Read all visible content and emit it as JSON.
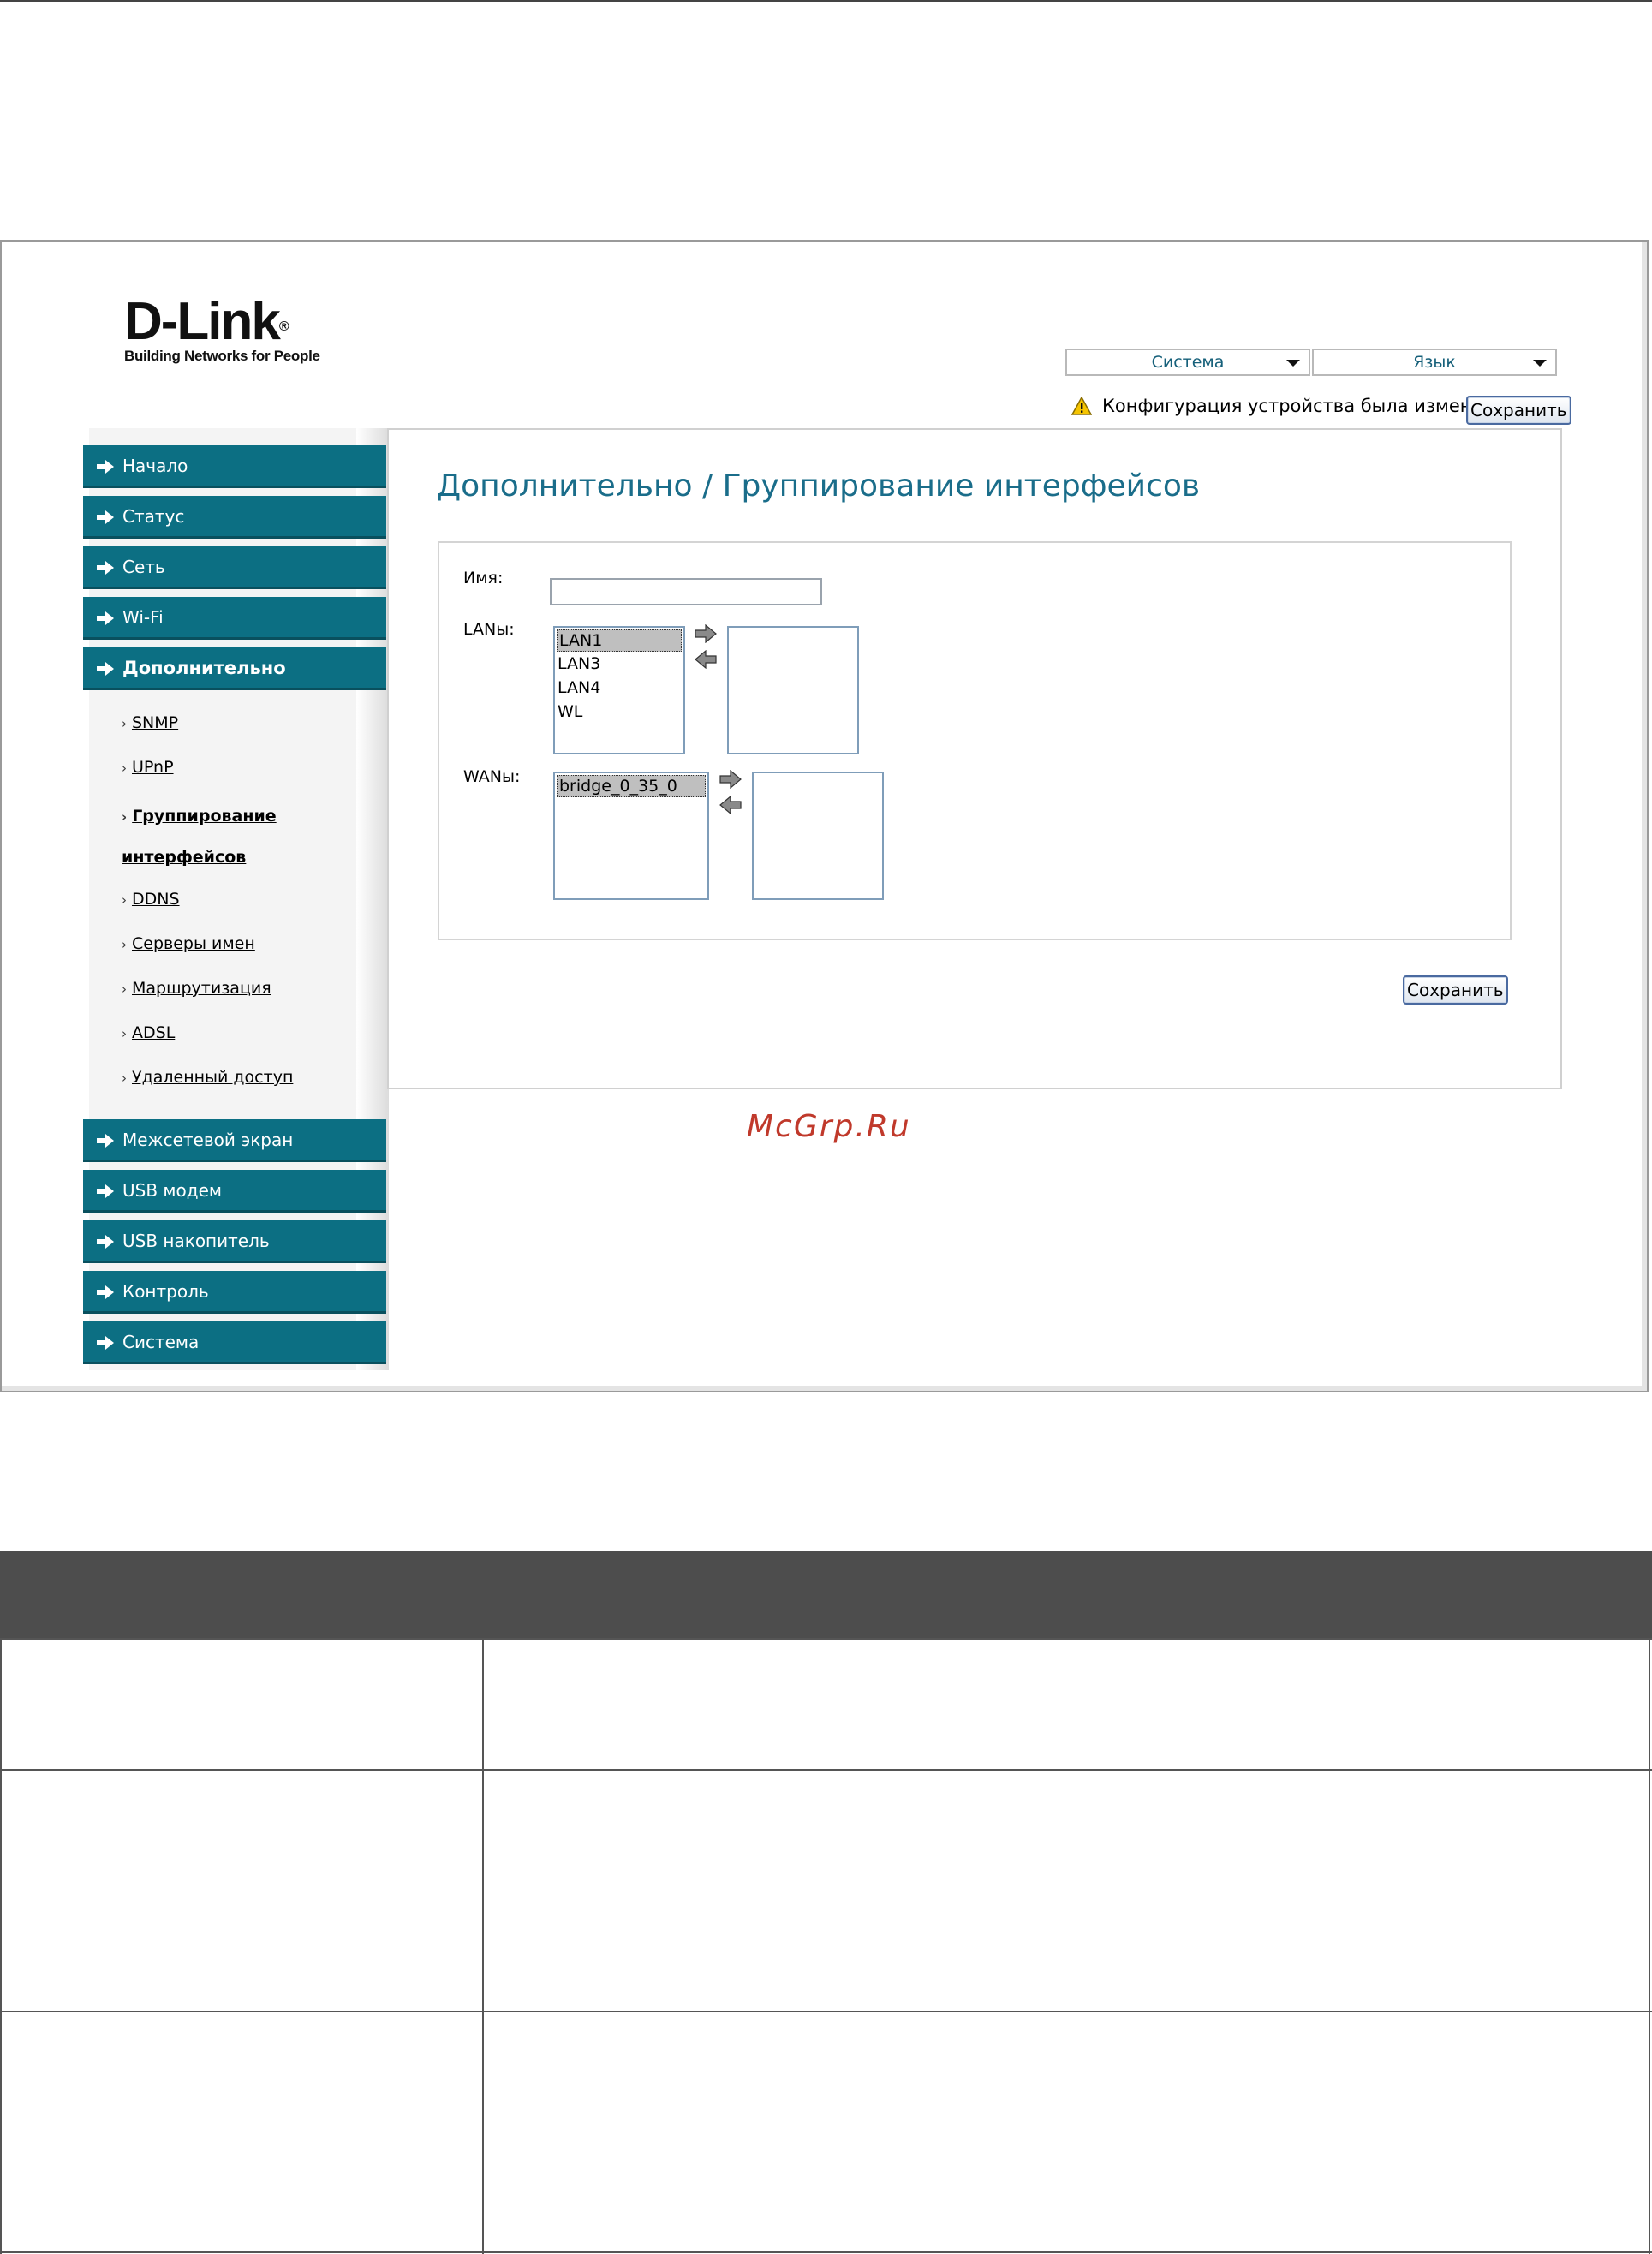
{
  "logo": {
    "brand": "D-Link",
    "tagline": "Building Networks for People"
  },
  "header": {
    "system_menu": "Система",
    "language_menu": "Язык",
    "notice_text": "Конфигурация устройства была изменена",
    "save_label": "Сохранить"
  },
  "sidebar": {
    "items": [
      {
        "label": "Начало"
      },
      {
        "label": "Статус"
      },
      {
        "label": "Сеть"
      },
      {
        "label": "Wi-Fi"
      },
      {
        "label": "Дополнительно"
      },
      {
        "label": "Межсетевой экран"
      },
      {
        "label": "USB модем"
      },
      {
        "label": "USB накопитель"
      },
      {
        "label": "Контроль"
      },
      {
        "label": "Система"
      }
    ],
    "subitems": [
      {
        "label": "SNMP"
      },
      {
        "label": "UPnP"
      },
      {
        "label": "Группирование",
        "label2": "интерфейсов"
      },
      {
        "label": "DDNS"
      },
      {
        "label": "Серверы имен"
      },
      {
        "label": "Маршрутизация"
      },
      {
        "label": "ADSL"
      },
      {
        "label": "Удаленный доступ"
      }
    ]
  },
  "main": {
    "title": "Дополнительно / Группирование интерфейсов",
    "name_label": "Имя:",
    "name_value": "",
    "lans_label": "LANы:",
    "lans_available": [
      "LAN1",
      "LAN3",
      "LAN4",
      "WL"
    ],
    "wans_label": "WANы:",
    "wans_available": [
      "bridge_0_35_0"
    ],
    "save_label": "Сохранить"
  },
  "watermark": "McGrp.Ru",
  "colors": {
    "nav": "#0c6f83",
    "title": "#1a6d8a",
    "table_header": "#4d4d4d"
  }
}
